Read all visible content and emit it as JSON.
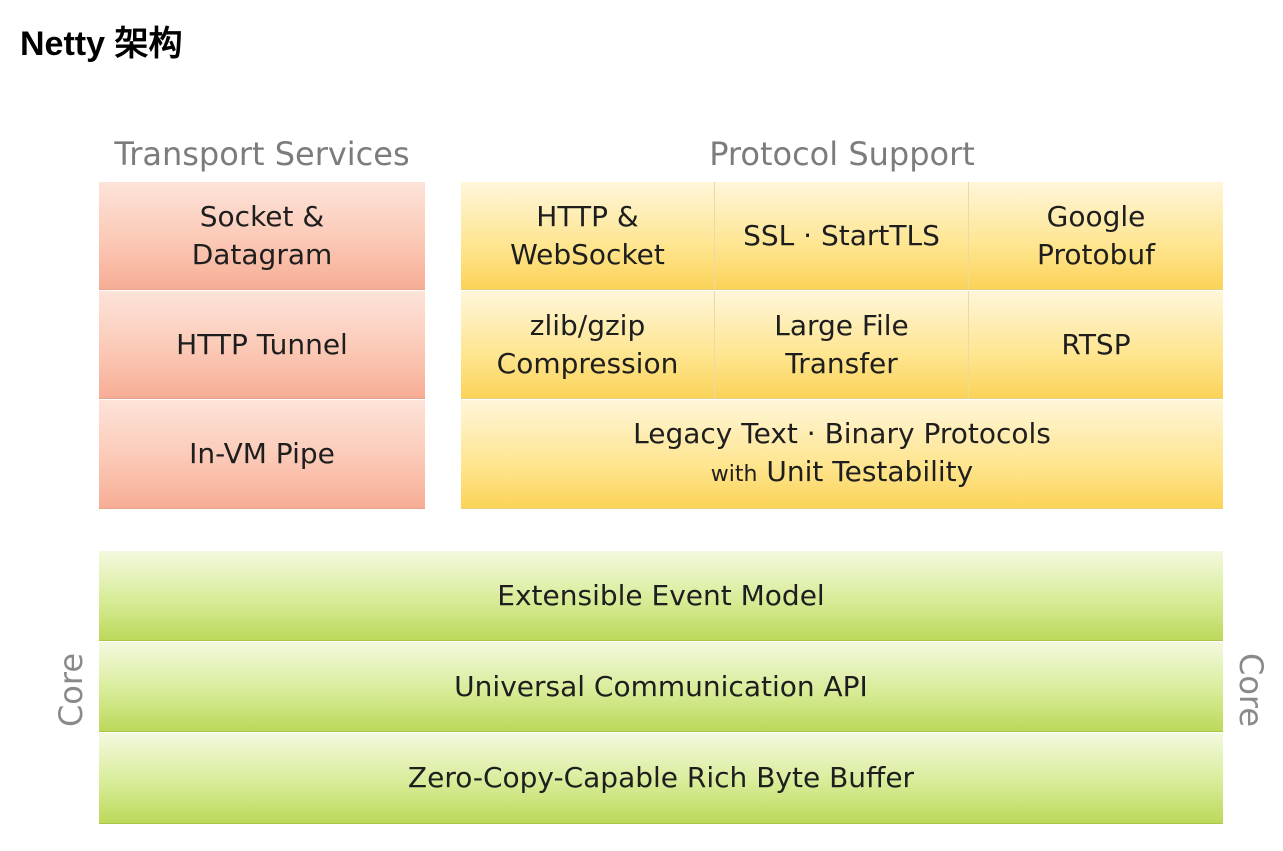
{
  "page": {
    "title": "Netty 架构"
  },
  "transport": {
    "heading": "Transport Services",
    "items": [
      {
        "line1": "Socket &",
        "line2": "Datagram"
      },
      {
        "line1": "HTTP Tunnel"
      },
      {
        "line1": "In-VM Pipe"
      }
    ]
  },
  "protocol": {
    "heading": "Protocol Support",
    "row1": [
      {
        "line1": "HTTP &",
        "line2": "WebSocket"
      },
      {
        "line1": "SSL · StartTLS"
      },
      {
        "line1": "Google",
        "line2": "Protobuf"
      }
    ],
    "row2": [
      {
        "line1": "zlib/gzip",
        "line2": "Compression"
      },
      {
        "line1": "Large File",
        "line2": "Transfer"
      },
      {
        "line1": "RTSP"
      }
    ],
    "legacy": {
      "line1": "Legacy Text · Binary Protocols",
      "prefix": "with",
      "line2": "Unit Testability"
    }
  },
  "core": {
    "side_label": "Core",
    "layers": [
      "Extensible Event Model",
      "Universal Communication API",
      "Zero-Copy-Capable Rich Byte Buffer"
    ]
  },
  "colors": {
    "transport": "#fbc9b6",
    "protocol": "#fee58f",
    "core": "#d8ec98",
    "heading_text": "#7c7c7c"
  }
}
